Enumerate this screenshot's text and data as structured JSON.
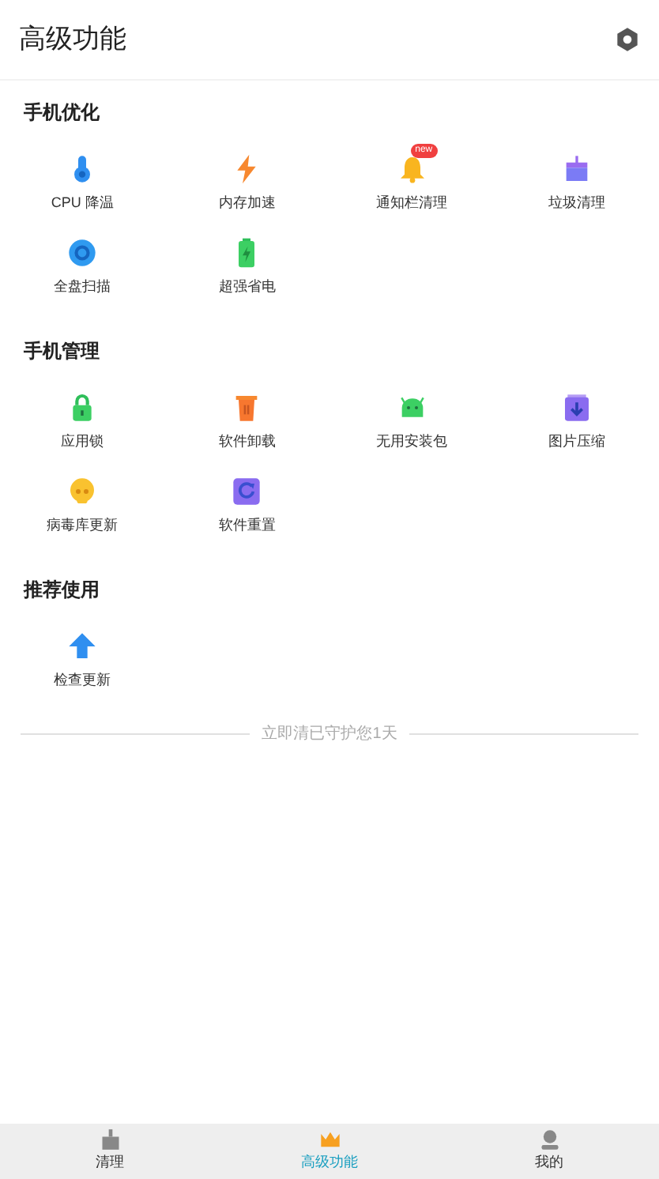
{
  "header": {
    "title": "高级功能"
  },
  "sections": [
    {
      "title": "手机优化",
      "items": [
        {
          "label": "CPU 降温"
        },
        {
          "label": "内存加速"
        },
        {
          "label": "通知栏清理",
          "badge": "new"
        },
        {
          "label": "垃圾清理"
        },
        {
          "label": "全盘扫描"
        },
        {
          "label": "超强省电"
        }
      ]
    },
    {
      "title": "手机管理",
      "items": [
        {
          "label": "应用锁"
        },
        {
          "label": "软件卸载"
        },
        {
          "label": "无用安装包"
        },
        {
          "label": "图片压缩"
        },
        {
          "label": "病毒库更新"
        },
        {
          "label": "软件重置"
        }
      ]
    },
    {
      "title": "推荐使用",
      "items": [
        {
          "label": "检查更新"
        }
      ]
    }
  ],
  "footer_note": "立即清已守护您1天",
  "tabs": [
    {
      "label": "清理",
      "selected": false
    },
    {
      "label": "高级功能",
      "selected": true
    },
    {
      "label": "我的",
      "selected": false
    }
  ]
}
